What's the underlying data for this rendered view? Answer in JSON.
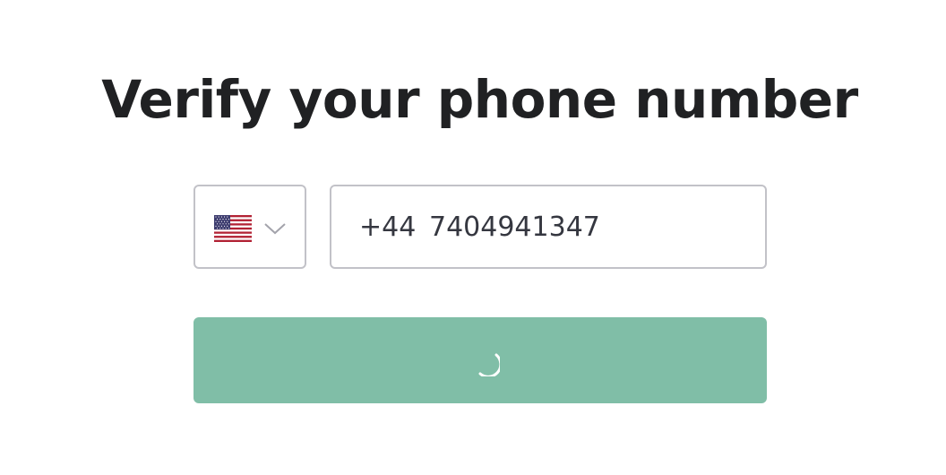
{
  "heading": {
    "title": "Verify your phone number"
  },
  "country_select": {
    "selected_country": "United States",
    "flag_icon": "us-flag-icon",
    "chevron_icon": "chevron-down-icon"
  },
  "phone": {
    "dial_code": "+44",
    "number": "7404941347"
  },
  "submit_button": {
    "state": "loading",
    "icon": "spinner-icon",
    "background_color": "#80bea7"
  },
  "colors": {
    "text": "#202123",
    "border": "#c2c2c8",
    "accent": "#80bea7"
  }
}
